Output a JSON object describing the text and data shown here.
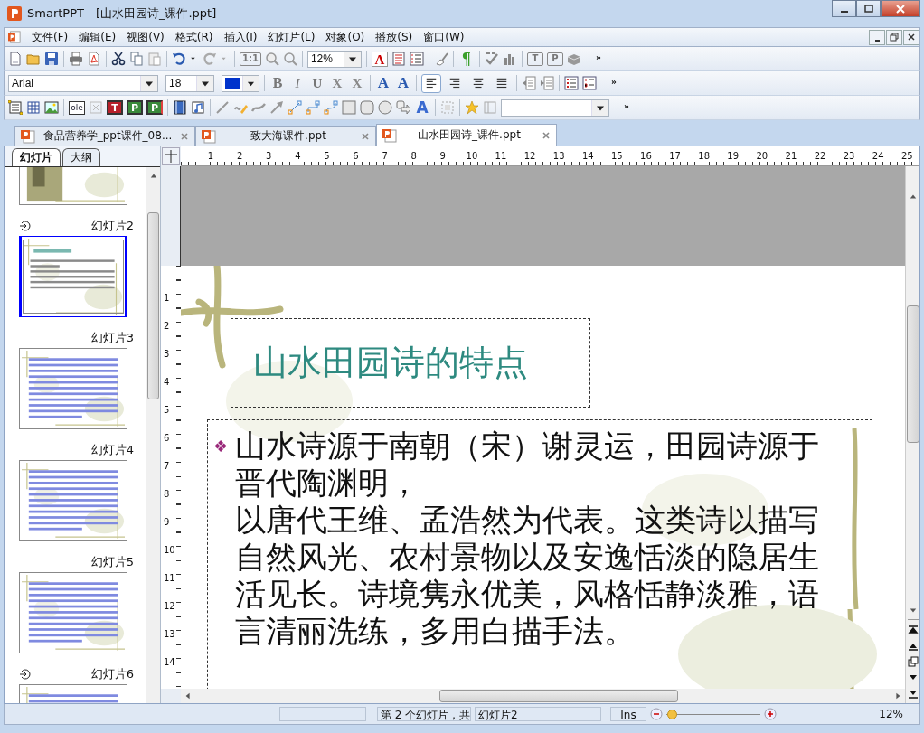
{
  "window": {
    "title": "SmartPPT - [山水田园诗_课件.ppt]"
  },
  "menu": [
    "文件(F)",
    "编辑(E)",
    "视图(V)",
    "格式(R)",
    "插入(I)",
    "幻灯片(L)",
    "对象(O)",
    "播放(S)",
    "窗口(W)"
  ],
  "toolbar_standard": {
    "zoom": "12%",
    "glyphs": [
      "1:1",
      "A",
      "¶",
      "T",
      "P",
      "»"
    ]
  },
  "toolbar_format": {
    "font": "Arial",
    "size": "18",
    "glyphs": [
      "B",
      "I",
      "U",
      "X",
      "X",
      "A",
      "A",
      "»"
    ],
    "alignment": [
      {
        "selected": true
      },
      {
        "selected": false
      },
      {
        "selected": false
      },
      {
        "selected": false
      }
    ]
  },
  "toolbar_drawing": {
    "glyphs": [
      "ole",
      "T",
      "P",
      "P",
      "A",
      "»"
    ]
  },
  "tabs": [
    {
      "label": "食品营养学_ppt课件_08...",
      "selected": false
    },
    {
      "label": "致大海课件.ppt",
      "selected": false
    },
    {
      "label": "山水田园诗_课件.ppt",
      "selected": true
    }
  ],
  "panel_tabs": [
    {
      "label": "幻灯片",
      "selected": true
    },
    {
      "label": "大纲",
      "selected": false
    }
  ],
  "thumbnails": [
    {
      "kind": "photo",
      "selected": false
    },
    {
      "label": "幻灯片2",
      "kind": "title-text",
      "transition": true,
      "selected": true
    },
    {
      "label": "幻灯片3",
      "kind": "text",
      "transition": false,
      "selected": false
    },
    {
      "label": "幻灯片4",
      "kind": "text",
      "transition": false,
      "selected": false
    },
    {
      "label": "幻灯片5",
      "kind": "text",
      "transition": false,
      "selected": false
    },
    {
      "label": "幻灯片6",
      "kind": "text",
      "transition": true,
      "selected": false
    }
  ],
  "ruler_h": [
    "1",
    "2",
    "3",
    "4",
    "5",
    "6",
    "7",
    "8",
    "9",
    "10",
    "11",
    "12",
    "13",
    "14",
    "15",
    "16",
    "17",
    "18",
    "19",
    "20",
    "21",
    "22",
    "23",
    "24",
    "25"
  ],
  "ruler_v": [
    "1",
    "2",
    "3",
    "4",
    "5",
    "6",
    "7",
    "8",
    "9",
    "10",
    "11",
    "12",
    "13",
    "14"
  ],
  "slide": {
    "title": "山水田园诗的特点",
    "bullet": "❖",
    "body": [
      "山水诗源于南朝（宋）谢灵运，田园诗源于晋代陶渊明，",
      "以唐代王维、孟浩然为代表。这类诗以描写自然风光、农村景物以及安逸恬淡的隐居生活见长。诗境隽永优美，风格恬静淡雅，语言清丽洗练，多用白描手法。"
    ]
  },
  "status_bar": {
    "position": "第 2 个幻灯片，共",
    "slide_name": "幻灯片2",
    "mode": "Ins",
    "zoom": {
      "level": 0.03
    },
    "zoom_label": "12%"
  }
}
